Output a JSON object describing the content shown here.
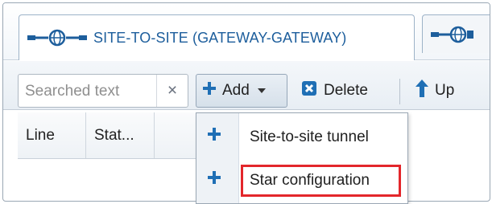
{
  "tabs": [
    {
      "label": "SITE-TO-SITE (GATEWAY-GATEWAY)",
      "icon": "network-globe-icon",
      "active": true
    },
    {
      "label": "",
      "icon": "network-globe-icon",
      "active": false
    }
  ],
  "search": {
    "placeholder": "Searched text",
    "clear_label": "×"
  },
  "toolbar": {
    "add_label": "Add",
    "delete_label": "Delete",
    "up_label": "Up"
  },
  "table": {
    "columns": [
      "Line",
      "Stat..."
    ]
  },
  "add_menu": {
    "items": [
      {
        "label": "Site-to-site tunnel",
        "icon": "plus-icon"
      },
      {
        "label": "Star configuration",
        "icon": "plus-icon",
        "highlighted": true
      }
    ]
  },
  "colors": {
    "accent": "#1d5e9c",
    "highlight": "#e3262b",
    "plus": "#1f6fb5"
  }
}
